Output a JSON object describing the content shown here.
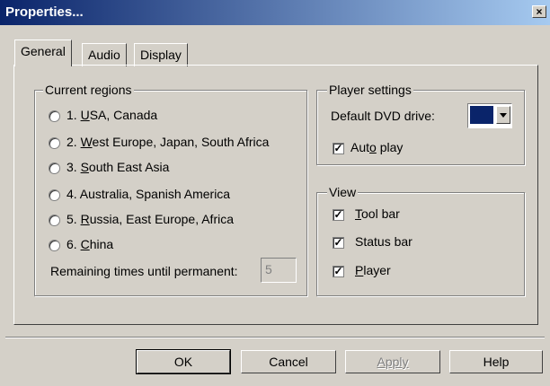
{
  "window": {
    "title": "Properties...",
    "close_glyph": "×"
  },
  "tabs": [
    {
      "label": "General",
      "active": true
    },
    {
      "label": "Audio",
      "active": false
    },
    {
      "label": "Display",
      "active": false
    }
  ],
  "regions": {
    "legend": "Current regions",
    "options": [
      {
        "num": "1. ",
        "mn": "U",
        "rest": "SA, Canada"
      },
      {
        "num": "2. ",
        "mn": "W",
        "rest": "est Europe, Japan, South Africa"
      },
      {
        "num": "3. ",
        "mn": "S",
        "rest": "outh East Asia"
      },
      {
        "pre": "4. Australia, Spanish America"
      },
      {
        "num": "5. ",
        "mn": "R",
        "rest": "ussia, East Europe, Africa"
      },
      {
        "num": "6. ",
        "mn": "C",
        "rest": "hina"
      }
    ],
    "remaining_label": "Remaining times until permanent:",
    "remaining_value": "5"
  },
  "player": {
    "legend": "Player settings",
    "drive_label": "Default DVD drive:",
    "drive_color": "#0a246a",
    "autoplay_pre": "Aut",
    "autoplay_mn": "o",
    "autoplay_post": " play",
    "autoplay_checked": true
  },
  "view": {
    "legend": "View",
    "toolbar_mn": "T",
    "toolbar_rest": "ool bar",
    "statusbar_label": "Status bar",
    "player_mn": "P",
    "player_rest": "layer",
    "check_glyph": "✓"
  },
  "buttons": {
    "ok": "OK",
    "cancel": "Cancel",
    "apply": "Apply",
    "help": "Help"
  }
}
